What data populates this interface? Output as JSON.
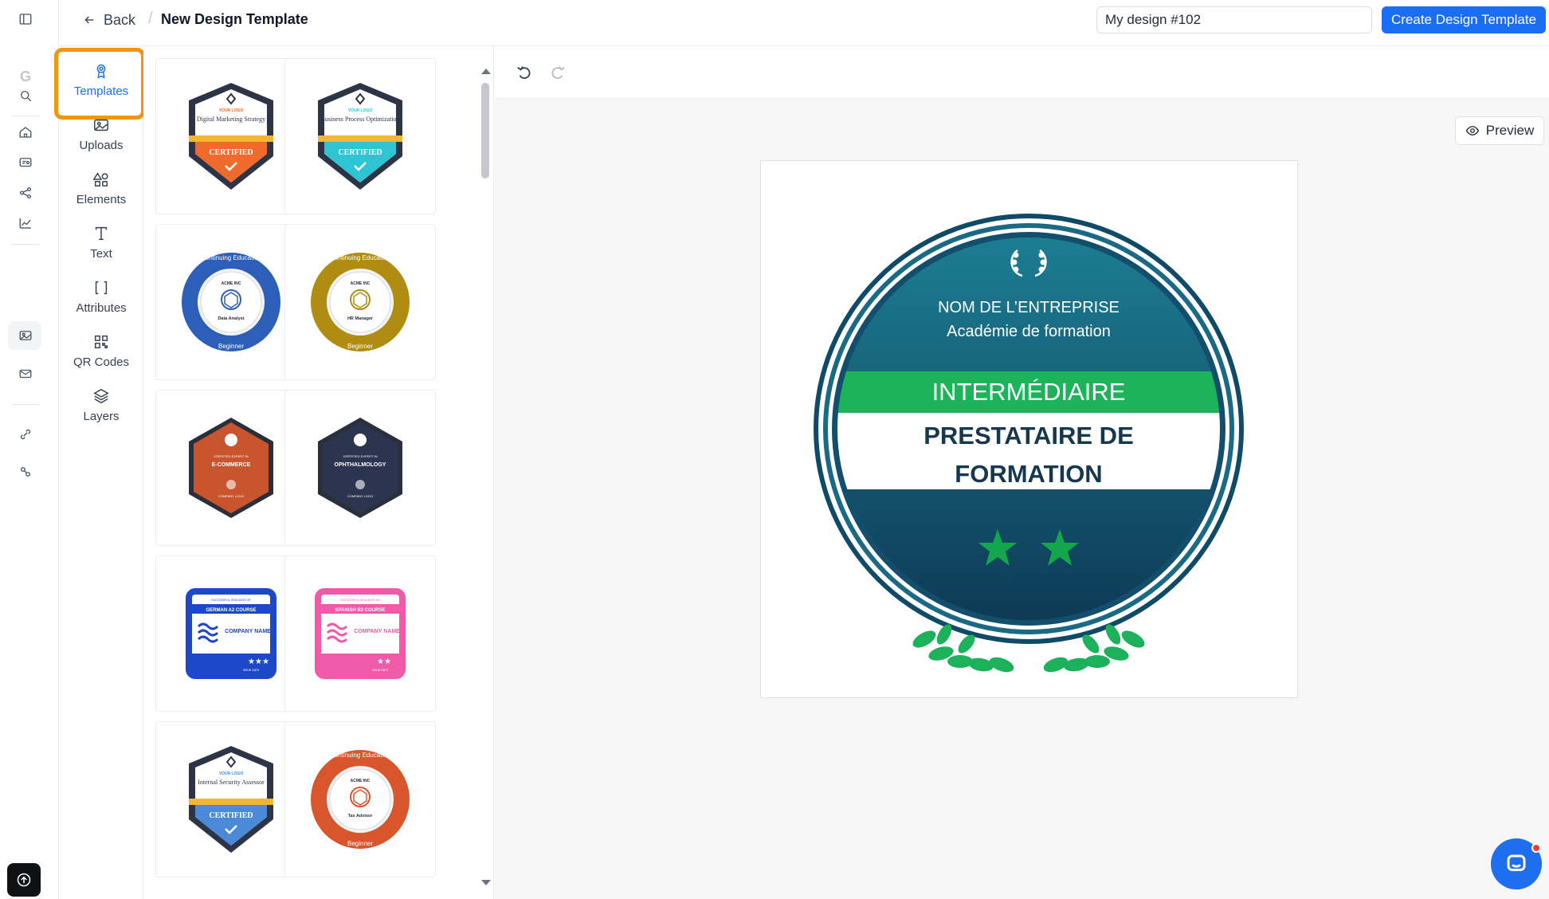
{
  "header": {
    "back_label": "Back",
    "title": "New Design Template",
    "design_name": "My design #102",
    "create_label": "Create Design Template"
  },
  "rail": {
    "logo_letter": "G",
    "icons": [
      "sidebar-toggle-icon",
      "search-icon",
      "home-icon",
      "badge-icon",
      "workflow-icon",
      "analytics-icon",
      "image-icon",
      "mail-icon",
      "integrations-icon",
      "settings-icon",
      "upload-icon"
    ]
  },
  "tools": [
    {
      "id": "templates",
      "label": "Templates",
      "icon": "award-icon",
      "active": true
    },
    {
      "id": "uploads",
      "label": "Uploads",
      "icon": "image-icon",
      "active": false
    },
    {
      "id": "elements",
      "label": "Elements",
      "icon": "shapes-icon",
      "active": false
    },
    {
      "id": "text",
      "label": "Text",
      "icon": "type-icon",
      "active": false
    },
    {
      "id": "attributes",
      "label": "Attributes",
      "icon": "brackets-icon",
      "active": false
    },
    {
      "id": "qrcodes",
      "label": "QR Codes",
      "icon": "qr-code-icon",
      "active": false
    },
    {
      "id": "layers",
      "label": "Layers",
      "icon": "layers-icon",
      "active": false
    }
  ],
  "templates": [
    {
      "kind": "shield",
      "accent": "#f06a2b",
      "title": "Digital Marketing Strategy",
      "top": "YOUR LOGO",
      "ribbon": "CERTIFIED"
    },
    {
      "kind": "shield",
      "accent": "#2ec4d1",
      "title": "Business Process Optimization",
      "top": "YOUR LOGO",
      "ribbon": "CERTIFIED"
    },
    {
      "kind": "round",
      "accent": "#2d5fb8",
      "ring_text": "Continuing Education",
      "company": "ACME INC",
      "role": "Data Analyst",
      "level": "Beginner"
    },
    {
      "kind": "round",
      "accent": "#b08d12",
      "ring_text": "Continuing Education",
      "company": "ACME INC",
      "role": "HR Manager",
      "level": "Beginner"
    },
    {
      "kind": "hex",
      "accent": "#c8552e",
      "top": "CERTIFIED EXPERT IN",
      "title": "E-COMMERCE",
      "logo": "COMPANY LOGO"
    },
    {
      "kind": "hex",
      "accent": "#2c3550",
      "top": "CERTIFIED EXPERT IN",
      "title": "OPHTHALMOLOGY",
      "logo": "COMPANY LOGO"
    },
    {
      "kind": "square",
      "accent": "#1c48c9",
      "top": "SUCCESSFUL GRADUATE OF",
      "course": "GERMAN A2 COURSE",
      "company": "COMPANY NAME",
      "stars": 3,
      "date": "ISSUE DATE"
    },
    {
      "kind": "square",
      "accent": "#f05aa8",
      "top": "SUCCESSFUL GRADUATE OF",
      "course": "SPANISH B2 COURSE",
      "company": "COMPANY NAME",
      "stars": 2,
      "date": "ISSUE DATE"
    },
    {
      "kind": "shield",
      "accent": "#4a8ad8",
      "title": "Internal Security Assessor",
      "top": "YOUR LOGO",
      "ribbon": "CERTIFIED"
    },
    {
      "kind": "round",
      "accent": "#d9552c",
      "ring_text": "Continuing Education",
      "company": "ACME INC",
      "role": "Tax Advisor",
      "level": "Beginner"
    }
  ],
  "canvas": {
    "company": "NOM DE L’ENTREPRISE",
    "academy": "Académie de formation",
    "level": "INTERMÉDIAIRE",
    "title_line1": "PRESTATAIRE DE",
    "title_line2": "FORMATION",
    "stars": 2,
    "colors": {
      "teal_top": "#1b7a8e",
      "teal_bottom": "#0f3d5a",
      "green": "#1db35a",
      "star": "#14a64d"
    }
  },
  "preview_label": "Preview",
  "colors": {
    "primary": "#1a6ef5",
    "highlight": "#f5940f"
  }
}
